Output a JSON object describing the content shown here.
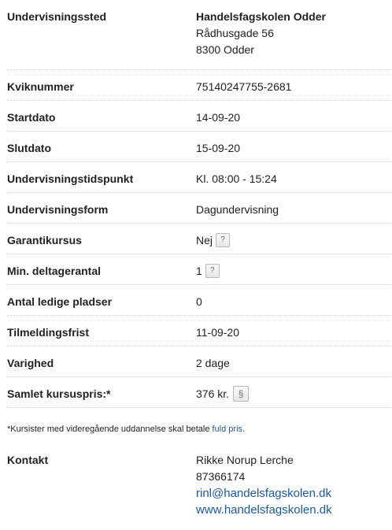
{
  "details": {
    "undervisningssted": {
      "label": "Undervisningssted",
      "name": "Handelsfagskolen Odder",
      "street": "Rådhusgade 56",
      "city": "8300 Odder"
    },
    "kviknummer": {
      "label": "Kviknummer",
      "value": "75140247755-2681"
    },
    "startdato": {
      "label": "Startdato",
      "value": "14-09-20"
    },
    "slutdato": {
      "label": "Slutdato",
      "value": "15-09-20"
    },
    "tidspunkt": {
      "label": "Undervisningstidspunkt",
      "value": "Kl. 08:00 - 15:24"
    },
    "form": {
      "label": "Undervisningsform",
      "value": "Dagundervisning"
    },
    "garanti": {
      "label": "Garantikursus",
      "value": "Nej",
      "help": "?"
    },
    "min_deltager": {
      "label": "Min. deltagerantal",
      "value": "1",
      "help": "?"
    },
    "ledige": {
      "label": "Antal ledige pladser",
      "value": "0"
    },
    "frist": {
      "label": "Tilmeldingsfrist",
      "value": "11-09-20"
    },
    "varighed": {
      "label": "Varighed",
      "value": "2 dage"
    },
    "pris": {
      "label": "Samlet kursuspris:*",
      "value": "376 kr.",
      "para_icon": "§"
    }
  },
  "footnote": {
    "text": "*Kursister med videregående uddannelse skal betale ",
    "link": "fuld pris."
  },
  "contact": {
    "label": "Kontakt",
    "name": "Rikke Norup Lerche",
    "phone": "87366174",
    "email": "rinl@handelsfagskolen.dk",
    "website": "www.handelsfagskolen.dk"
  },
  "colors": {
    "link": "#1a5aa8",
    "text": "#222222",
    "divider": "#cfcfcf"
  }
}
